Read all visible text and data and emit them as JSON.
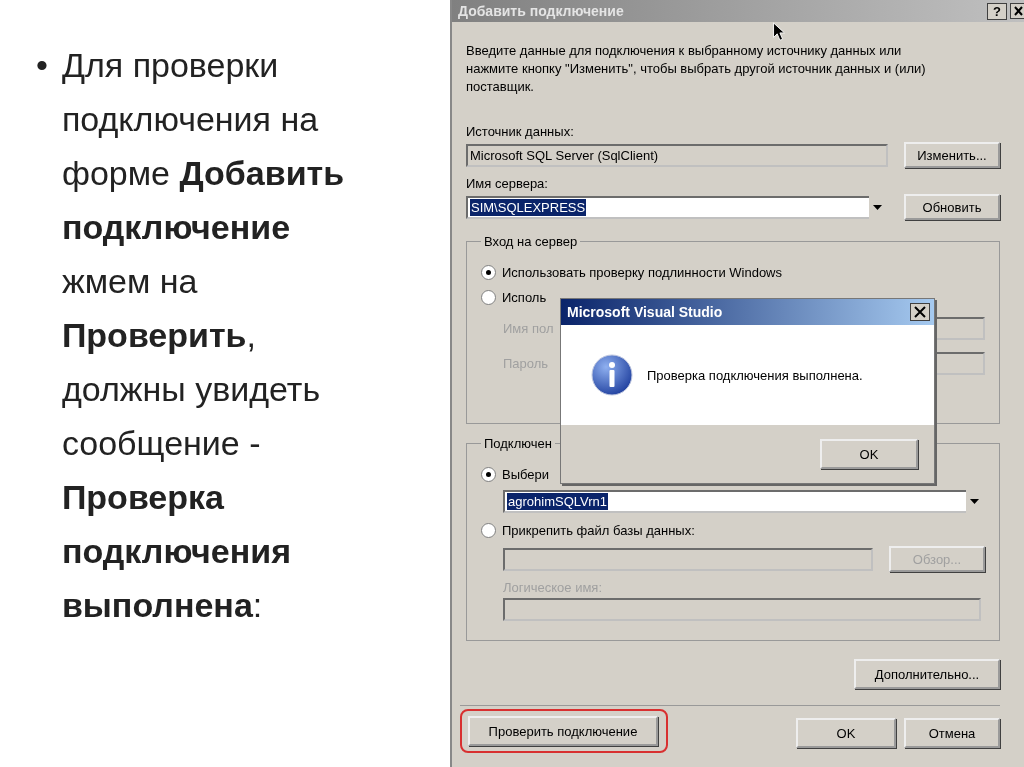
{
  "slide": {
    "bullet": "•",
    "text": "Для проверки подключения на форме **Добавить подключение** жмем на **Проверить**, должны увидеть сообщение - **Проверка подключения выполнена**:"
  },
  "dialog": {
    "title": "Добавить подключение",
    "help_button": "?",
    "intro": "Введите данные для подключения к выбранному источнику данных или нажмите кнопку \"Изменить\", чтобы выбрать другой источник данных и (или) поставщик.",
    "source_label": "Источник данных:",
    "source_value": "Microsoft SQL Server (SqlClient)",
    "change_button": "Изменить...",
    "server_label": "Имя сервера:",
    "server_value": "SIM\\SQLEXPRESS",
    "refresh_button": "Обновить",
    "login_group": {
      "title": "Вход на сервер",
      "options": [
        {
          "label": "Использовать проверку подлинности Windows",
          "selected": true
        },
        {
          "label": "Исполь",
          "selected": false
        }
      ],
      "fields": [
        {
          "label": "Имя пол",
          "disabled": true
        },
        {
          "label": "Пароль",
          "disabled": true
        }
      ]
    },
    "db_group": {
      "title": "Подключен",
      "select_option": {
        "label": "Выбери",
        "selected": true,
        "value": "agrohimSQLVrn1"
      },
      "attach_option": {
        "label": "Прикрепить файл базы данных:",
        "selected": false
      },
      "browse_button": {
        "label": "Обзор...",
        "disabled": true
      },
      "logical_name": {
        "label": "Логическое имя:",
        "disabled": true
      }
    },
    "advanced_button": "Дополнительно...",
    "buttons": [
      {
        "label": "Проверить подключение",
        "highlighted": true
      },
      {
        "label": "OK",
        "highlighted": false
      },
      {
        "label": "Отмена",
        "highlighted": false
      }
    ]
  },
  "message_box": {
    "title": "Microsoft Visual Studio",
    "message": "Проверка подключения выполнена.",
    "ok_button": "OK"
  }
}
